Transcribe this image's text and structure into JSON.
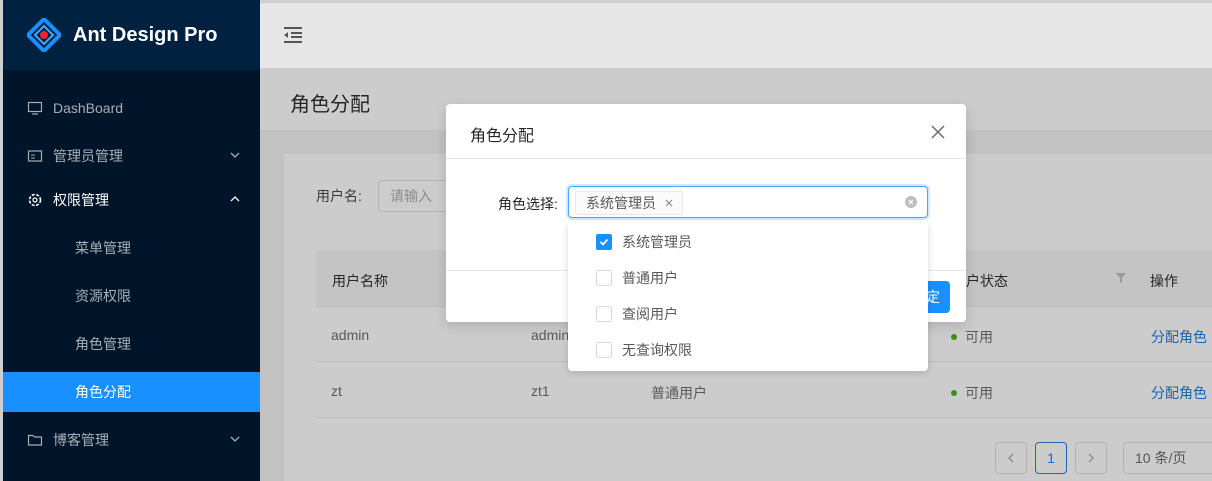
{
  "app": {
    "title": "Ant Design Pro"
  },
  "sidebar": {
    "items": [
      {
        "label": "DashBoard",
        "icon": "desktop-icon"
      },
      {
        "label": "管理员管理",
        "icon": "idcard-icon"
      },
      {
        "label": "权限管理",
        "icon": "setting-icon"
      },
      {
        "label": "菜单管理"
      },
      {
        "label": "资源权限"
      },
      {
        "label": "角色管理"
      },
      {
        "label": "角色分配"
      },
      {
        "label": "博客管理",
        "icon": "folder-icon"
      }
    ]
  },
  "page": {
    "title": "角色分配"
  },
  "search": {
    "label": "用户名:",
    "placeholder": "请输入"
  },
  "table": {
    "headers": [
      "用户名称",
      "户状态",
      "操作"
    ],
    "rows": [
      {
        "name": "admin",
        "account": "admin",
        "role": "",
        "status": "可用",
        "action": "分配角色"
      },
      {
        "name": "zt",
        "account": "zt1",
        "role": "普通用户",
        "status": "可用",
        "action": "分配角色"
      }
    ]
  },
  "pagination": {
    "current": "1",
    "page_size": "10 条/页"
  },
  "modal": {
    "title": "角色分配",
    "form_label": "角色选择:",
    "selected_tag": "系统管理员",
    "ok_label": "定"
  },
  "dropdown": {
    "options": [
      {
        "label": "系统管理员",
        "checked": true
      },
      {
        "label": "普通用户",
        "checked": false
      },
      {
        "label": "查阅用户",
        "checked": false
      },
      {
        "label": "无查询权限",
        "checked": false
      }
    ]
  },
  "colors": {
    "primary": "#1890ff",
    "sider": "#001529",
    "success": "#52c41a"
  }
}
